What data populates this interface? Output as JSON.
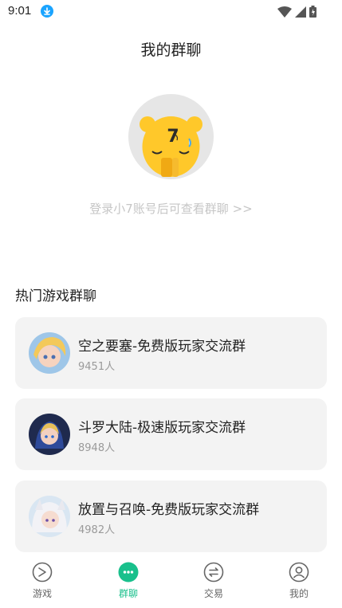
{
  "status_bar": {
    "time": "9:01"
  },
  "header": {
    "title": "我的群聊"
  },
  "mascot": {
    "badge_text": "7"
  },
  "login_hint": "登录小7账号后可查看群聊 >>",
  "hot_section": {
    "title": "热门游戏群聊",
    "groups": [
      {
        "name": "空之要塞-免费版玩家交流群",
        "members": "9451人"
      },
      {
        "name": "斗罗大陆-极速版玩家交流群",
        "members": "8948人"
      },
      {
        "name": "放置与召唤-免费版玩家交流群",
        "members": "4982人"
      }
    ]
  },
  "tab_bar": {
    "tabs": [
      {
        "label": "游戏",
        "icon": "game-icon",
        "active": false
      },
      {
        "label": "群聊",
        "icon": "chat-icon",
        "active": true
      },
      {
        "label": "交易",
        "icon": "trade-icon",
        "active": false
      },
      {
        "label": "我的",
        "icon": "profile-icon",
        "active": false
      }
    ]
  },
  "colors": {
    "accent": "#19c08c",
    "hint_text": "#c6c6c6",
    "card_bg": "#f3f3f3",
    "mascot_yellow": "#ffc82a",
    "download_badge": "#1aa4ff"
  }
}
